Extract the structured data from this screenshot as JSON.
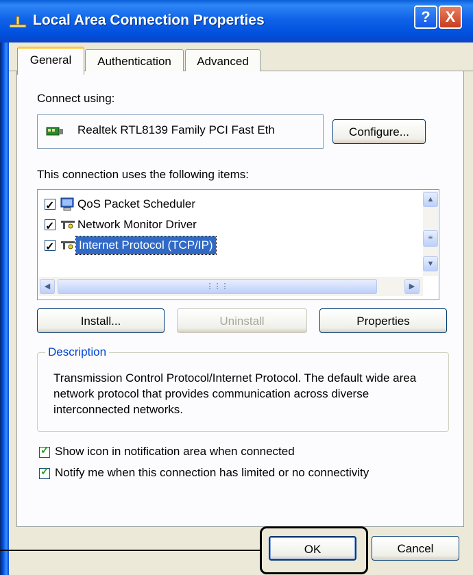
{
  "window": {
    "title": "Local Area Connection Properties",
    "help_label": "?",
    "close_label": "X"
  },
  "tabs": [
    {
      "label": "General",
      "active": true
    },
    {
      "label": "Authentication",
      "active": false
    },
    {
      "label": "Advanced",
      "active": false
    }
  ],
  "connect_using_label": "Connect using:",
  "adapter_name": "Realtek RTL8139 Family PCI Fast Eth",
  "configure_label": "Configure...",
  "items_label": "This connection uses the following items:",
  "items": [
    {
      "label": "QoS Packet Scheduler",
      "checked": true,
      "selected": false,
      "icon": "scheduler-icon"
    },
    {
      "label": "Network Monitor Driver",
      "checked": true,
      "selected": false,
      "icon": "network-protocol-icon"
    },
    {
      "label": "Internet Protocol (TCP/IP)",
      "checked": true,
      "selected": true,
      "icon": "network-protocol-icon"
    }
  ],
  "buttons": {
    "install": "Install...",
    "uninstall": "Uninstall",
    "properties": "Properties",
    "ok": "OK",
    "cancel": "Cancel"
  },
  "description": {
    "legend": "Description",
    "text": "Transmission Control Protocol/Internet Protocol. The default wide area network protocol that provides communication across diverse interconnected networks."
  },
  "options": [
    {
      "label": "Show icon in notification area when connected",
      "checked": true
    },
    {
      "label": "Notify me when this connection has limited or no connectivity",
      "checked": true
    }
  ],
  "colors": {
    "title_bar": "#0054e3",
    "selection": "#316ac5",
    "dialog_bg": "#ece9d8",
    "legend_text": "#0046d5"
  }
}
